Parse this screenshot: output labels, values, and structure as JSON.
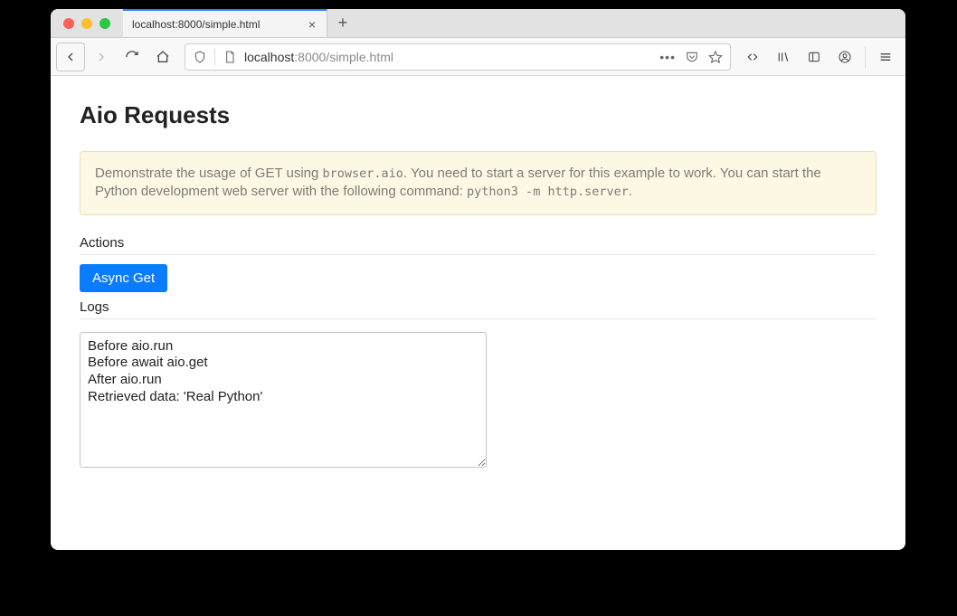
{
  "browser": {
    "tab_title": "localhost:8000/simple.html",
    "url_host": "localhost",
    "url_port_path": ":8000/simple.html"
  },
  "page": {
    "heading": "Aio Requests",
    "banner_pre": "Demonstrate the usage of GET using ",
    "banner_code1": "browser.aio",
    "banner_mid": ". You need to start a server for this example to work. You can start the Python development web server with the following command: ",
    "banner_code2": "python3 -m http.server",
    "banner_post": ".",
    "actions_label": "Actions",
    "async_get_label": "Async Get",
    "logs_label": "Logs",
    "logs_value": "Before aio.run\nBefore await aio.get\nAfter aio.run\nRetrieved data: 'Real Python'"
  }
}
